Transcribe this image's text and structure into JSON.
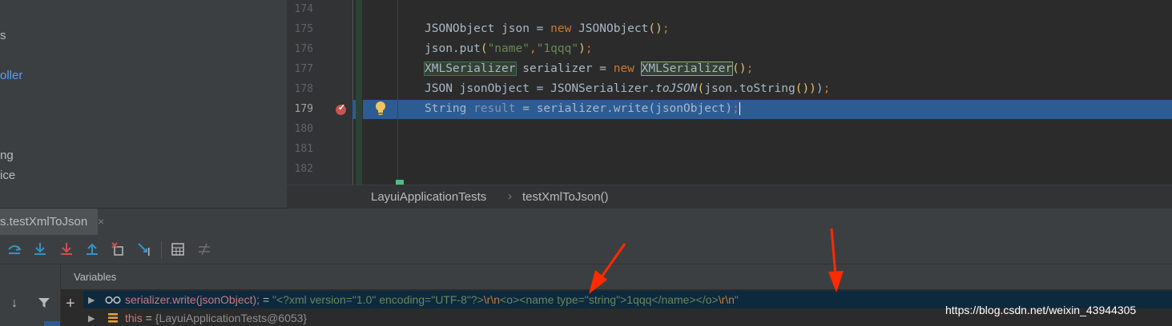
{
  "project_tree": {
    "items": [
      {
        "label": "s",
        "blue": false
      },
      {
        "label": "oller",
        "blue": true
      },
      {
        "label": "ng",
        "blue": false
      },
      {
        "label": "ice",
        "blue": false
      }
    ]
  },
  "editor": {
    "line_numbers": [
      "174",
      "175",
      "176",
      "177",
      "178",
      "179",
      "180",
      "181",
      "182"
    ],
    "lines": [
      "",
      "JSONObject json = new JSONObject();",
      "json.put(\"name\",\"1qqq\");",
      "XMLSerializer serializer = new XMLSerializer();",
      "JSON jsonObject = JSONSerializer.toJSON(json.toString());",
      "String result = serializer.write(jsonObject);",
      "",
      "",
      ""
    ],
    "current_line": "179"
  },
  "breadcrumb": {
    "items": [
      "LayuiApplicationTests",
      "testXmlToJson()"
    ],
    "separator": "›"
  },
  "debug_tab": {
    "label": "s.testXmlToJson",
    "close": "×"
  },
  "toolbar": {
    "icons": [
      "step-over-icon",
      "step-into-icon",
      "force-step-into-icon",
      "step-out-icon",
      "drop-frame-icon",
      "run-to-cursor-icon",
      "evaluate-expression-icon",
      "trace-icon"
    ]
  },
  "variables": {
    "header": "Variables",
    "plus": "+",
    "rows": [
      {
        "expand": "▶",
        "icon": "watch-icon",
        "name": "serializer.write(jsonObject);",
        "equals": " = ",
        "value_parts": [
          {
            "text": "\"<?xml version=\"1.0\" encoding=\"UTF-8\"?>",
            "kind": "str"
          },
          {
            "text": "\\r\\n",
            "kind": "esc"
          },
          {
            "text": "<o><name type=\"string\">1qqq</name></o>",
            "kind": "str"
          },
          {
            "text": "\\r\\n",
            "kind": "esc"
          },
          {
            "text": "\"",
            "kind": "str"
          }
        ]
      },
      {
        "expand": "▶",
        "icon": "field-icon",
        "name": "this",
        "equals": " = ",
        "value_parts": [
          {
            "text": "{LayuiApplicationTests@6053}",
            "kind": "gray"
          }
        ]
      }
    ]
  },
  "watermark": "https://blog.csdn.net/weixin_43944305",
  "colors": {
    "background": "#2b2b2b",
    "execution_line": "#2d5c93",
    "keyword": "#cc7832",
    "string": "#6a8759",
    "annotation_arrow": "#ff2a00"
  }
}
